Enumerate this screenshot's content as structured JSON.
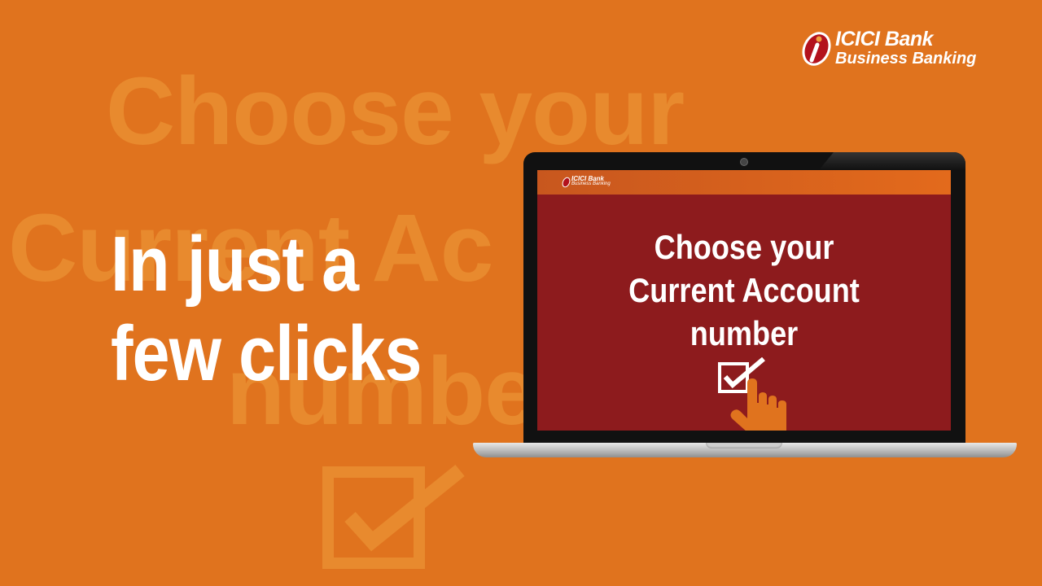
{
  "background_words": {
    "line1": "Choose your",
    "line2": "Current Ac",
    "line3": "numbe"
  },
  "headline": {
    "line1": "In just a",
    "line2": "few clicks"
  },
  "brand": {
    "line1": "ICICI Bank",
    "line2": "Business Banking"
  },
  "screen": {
    "logo_line1": "ICICI Bank",
    "logo_line2": "Business Banking",
    "title_line1": "Choose your",
    "title_line2": "Current Account",
    "title_line3": "number"
  },
  "colors": {
    "background": "#e0731e",
    "screen": "#8d1b1d",
    "brand_red": "#b3121d"
  },
  "icons": [
    "logo-icon",
    "checkbox-icon",
    "hand-pointer-icon"
  ]
}
